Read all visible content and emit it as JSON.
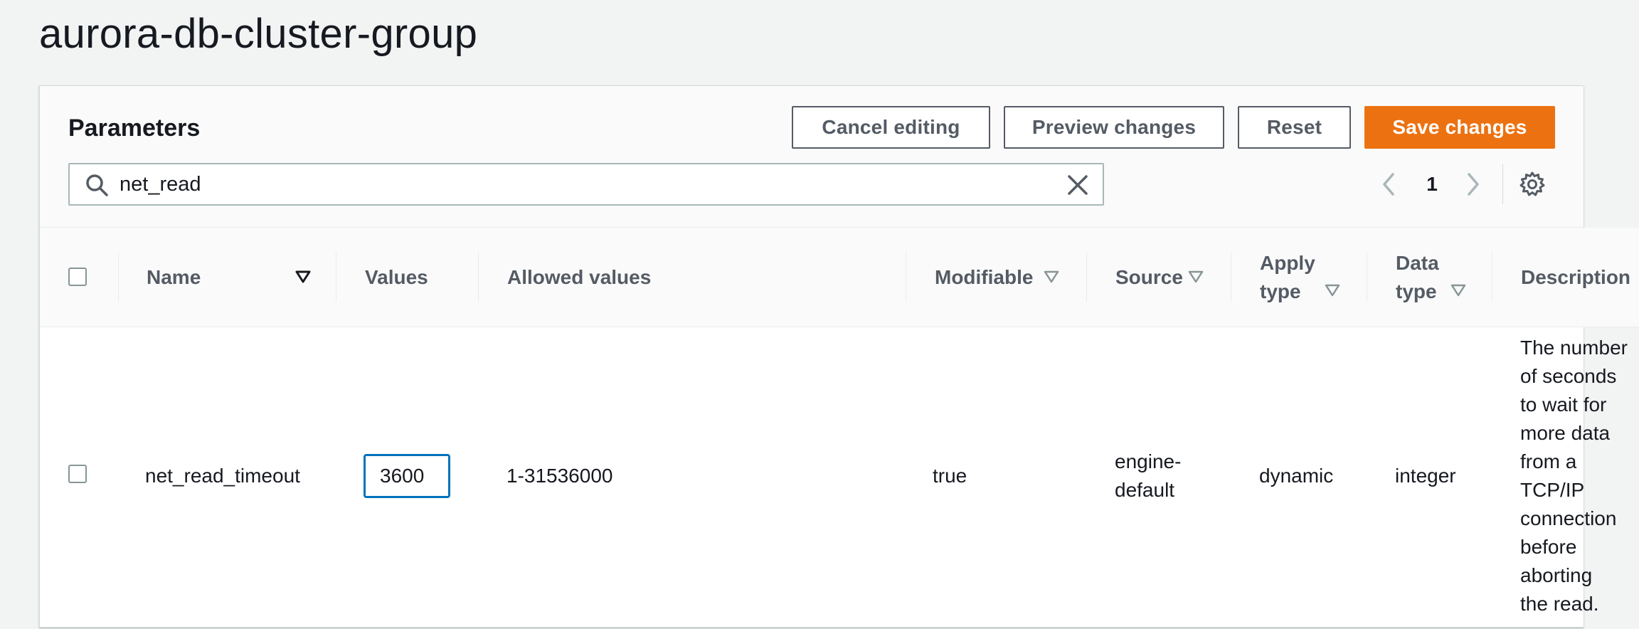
{
  "page": {
    "title": "aurora-db-cluster-group"
  },
  "panel": {
    "title": "Parameters",
    "buttons": {
      "cancel": "Cancel editing",
      "preview": "Preview changes",
      "reset": "Reset",
      "save": "Save changes"
    },
    "search": {
      "value": "net_read",
      "icon": "search-icon",
      "clear_icon": "close-icon"
    },
    "pagination": {
      "current_page": "1"
    }
  },
  "table": {
    "columns": {
      "name": "Name",
      "values": "Values",
      "allowed": "Allowed values",
      "modifiable": "Modifiable",
      "source": "Source",
      "apply_type_1": "Apply",
      "apply_type_2": "type",
      "data_type_1": "Data",
      "data_type_2": "type",
      "description": "Description"
    },
    "rows": [
      {
        "name": "net_read_timeout",
        "value": "3600",
        "allowed": "1-31536000",
        "modifiable": "true",
        "source_1": "engine-",
        "source_2": "default",
        "apply_type": "dynamic",
        "data_type": "integer",
        "description_lines": [
          "The number",
          "of seconds",
          "to wait for",
          "more data",
          "from a",
          "TCP/IP",
          "connection",
          "before",
          "aborting",
          "the read."
        ]
      }
    ]
  },
  "colors": {
    "accent": "#ec7211",
    "focus": "#0073bb",
    "text": "#16191f",
    "muted": "#545b64"
  }
}
